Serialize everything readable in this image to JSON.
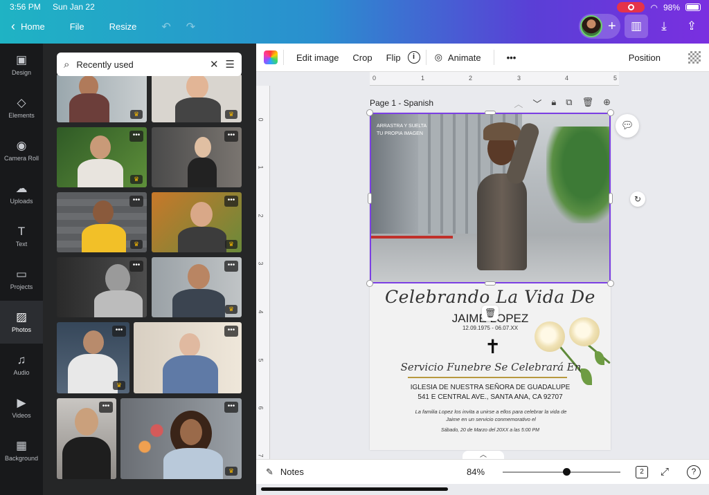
{
  "status": {
    "time": "3:56 PM",
    "date": "Sun Jan 22",
    "battery": "98%"
  },
  "nav": {
    "home": "Home",
    "file": "File",
    "resize": "Resize"
  },
  "rail": [
    {
      "label": "Design",
      "icon": "layout-icon"
    },
    {
      "label": "Elements",
      "icon": "shapes-icon"
    },
    {
      "label": "Camera Roll",
      "icon": "camera-icon"
    },
    {
      "label": "Uploads",
      "icon": "cloud-upload-icon"
    },
    {
      "label": "Text",
      "icon": "text-icon"
    },
    {
      "label": "Projects",
      "icon": "folder-icon"
    },
    {
      "label": "Photos",
      "icon": "image-icon"
    },
    {
      "label": "Audio",
      "icon": "music-icon"
    },
    {
      "label": "Videos",
      "icon": "video-icon"
    },
    {
      "label": "Background",
      "icon": "pattern-icon"
    }
  ],
  "search": {
    "value": "Recently used"
  },
  "toolbar": {
    "edit_image": "Edit image",
    "crop": "Crop",
    "flip": "Flip",
    "animate": "Animate",
    "more": "•••",
    "position": "Position"
  },
  "ruler": {
    "h": [
      "0",
      "1",
      "2",
      "3",
      "4",
      "5"
    ],
    "v": [
      "0",
      "1",
      "2",
      "3",
      "4",
      "5",
      "6",
      "7"
    ]
  },
  "page": {
    "label": "Page 1 - Spanish"
  },
  "design": {
    "overlay": "ARRASTRA Y SUELTA TU PROPIA IMAGEN",
    "title": "Celebrando La Vida De",
    "name": "JAIME LOPEZ",
    "dates": "12.09.1975 - 06.07.XX",
    "cross": "✝",
    "subtitle": "Servicio Funebre Se Celebrará En",
    "church": "IGLESIA DE NUESTRA SEÑORA DE GUADALUPE",
    "address": "541 E CENTRAL AVE., SANTA ANA, CA 92707",
    "invite": "La familia Lopez los invita a unirse a ellos para celebrar la vida de Jaime en un servicio conmemorativo el",
    "when": "Sábado, 20 de Marzo del 20XX a las 5:00 PM"
  },
  "bottom": {
    "notes": "Notes",
    "zoom": "84%",
    "pages": "2",
    "help": "?"
  },
  "colors": {
    "accent": "#7b3fe4",
    "gold": "#b8983e"
  }
}
